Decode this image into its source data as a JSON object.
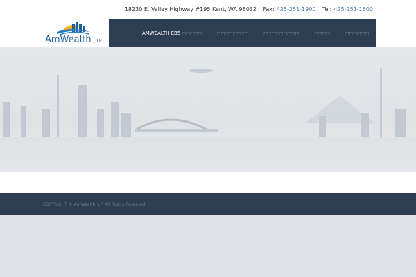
{
  "header": {
    "address": "18230 E. Valley Highway #195 Kent, WA 98032",
    "fax_label": "Fax:",
    "fax": "425-251-1900",
    "tel_label": "Tel:",
    "tel": "425-251-1600"
  },
  "logo": {
    "name": "AmWealth",
    "suffix": ", LP"
  },
  "nav": [
    {
      "label": "AMWEALTH EB5",
      "placeholder": "□□□□□"
    },
    {
      "label": "",
      "placeholder": "□□□□□□□□"
    },
    {
      "label": "",
      "placeholder": "□□□□□□□□□"
    },
    {
      "label": "",
      "placeholder": "□□□□"
    },
    {
      "label": "",
      "placeholder": "□□□□□□"
    }
  ],
  "footer": {
    "copyright": "COPYRIGHT © AmWealth, LP. All Rights Reserved."
  }
}
